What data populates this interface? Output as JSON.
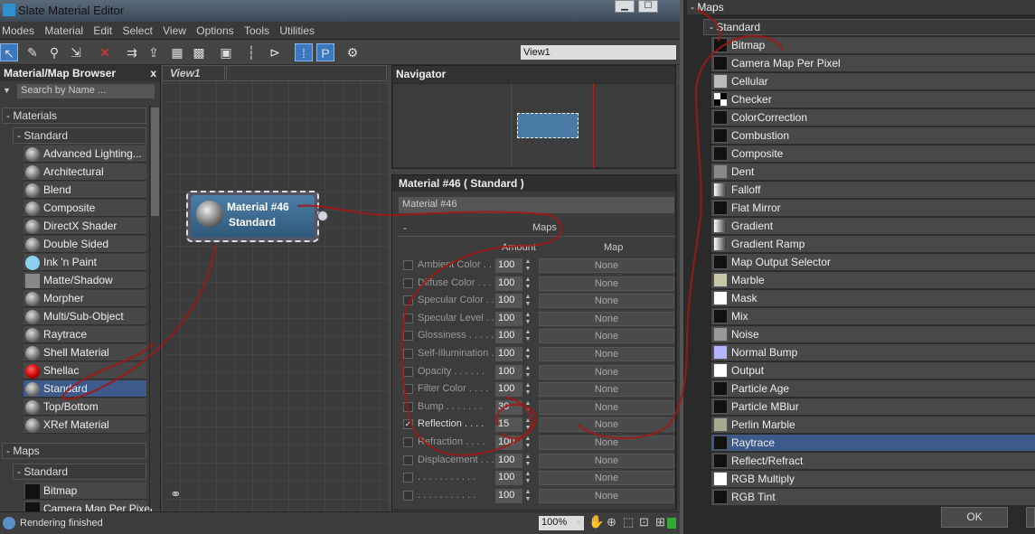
{
  "window": {
    "title": "Slate Material Editor"
  },
  "menu": [
    "Modes",
    "Material",
    "Edit",
    "Select",
    "View",
    "Options",
    "Tools",
    "Utilities"
  ],
  "view_selector": {
    "value": "View1"
  },
  "browser": {
    "title": "Material/Map Browser",
    "close": "x",
    "search_placeholder": "Search by Name ...",
    "materials_group": "- Materials",
    "standard_group": "- Standard",
    "materials": [
      {
        "label": "Advanced Lighting..."
      },
      {
        "label": "Architectural"
      },
      {
        "label": "Blend"
      },
      {
        "label": "Composite"
      },
      {
        "label": "DirectX Shader"
      },
      {
        "label": "Double Sided"
      },
      {
        "label": "Ink 'n Paint"
      },
      {
        "label": "Matte/Shadow"
      },
      {
        "label": "Morpher"
      },
      {
        "label": "Multi/Sub-Object"
      },
      {
        "label": "Raytrace"
      },
      {
        "label": "Shell Material"
      },
      {
        "label": "Shellac"
      },
      {
        "label": "Standard"
      },
      {
        "label": "Top/Bottom"
      },
      {
        "label": "XRef Material"
      }
    ],
    "selected_material": "Standard",
    "maps_group": "- Maps",
    "maps_standard_group": "- Standard",
    "maps_items": [
      {
        "label": "Bitmap"
      },
      {
        "label": "Camera Map Per Pixel"
      }
    ]
  },
  "view": {
    "tab": "View1",
    "node": {
      "name": "Material #46",
      "type": "Standard"
    }
  },
  "navigator": {
    "title": "Navigator"
  },
  "material": {
    "title": "Material #46  ( Standard )",
    "name_value": "Material #46",
    "rollout": "Maps",
    "rollout_collapse": "-",
    "col_amount": "Amount",
    "col_map": "Map",
    "params": [
      {
        "name": "Ambient Color . .",
        "amount": "100",
        "map": "None",
        "checked": false
      },
      {
        "name": "Diffuse Color . . . .",
        "amount": "100",
        "map": "None",
        "checked": false
      },
      {
        "name": "Specular Color  . .",
        "amount": "100",
        "map": "None",
        "checked": false
      },
      {
        "name": "Specular Level  . .",
        "amount": "100",
        "map": "None",
        "checked": false
      },
      {
        "name": "Glossiness . . . . .",
        "amount": "100",
        "map": "None",
        "checked": false
      },
      {
        "name": "Self-Illumination . .",
        "amount": "100",
        "map": "None",
        "checked": false
      },
      {
        "name": "Opacity . . . . . .",
        "amount": "100",
        "map": "None",
        "checked": false
      },
      {
        "name": "Filter Color  . . . .",
        "amount": "100",
        "map": "None",
        "checked": false
      },
      {
        "name": "Bump  . . . . . . .",
        "amount": "30",
        "map": "None",
        "checked": false
      },
      {
        "name": "Reflection  . . . .",
        "amount": "15",
        "map": "None",
        "checked": true
      },
      {
        "name": "Refraction  . . . .",
        "amount": "100",
        "map": "None",
        "checked": false
      },
      {
        "name": "Displacement  . . .",
        "amount": "100",
        "map": "None",
        "checked": false
      },
      {
        "name": ". . . . . . . . . . .",
        "amount": "100",
        "map": "None",
        "checked": false
      },
      {
        "name": ". . . . . . . . . . .",
        "amount": "100",
        "map": "None",
        "checked": false
      }
    ]
  },
  "status": {
    "text": "Rendering finished",
    "zoom": "100%"
  },
  "maps_panel": {
    "header": "- Maps",
    "subheader": "- Standard",
    "items": [
      {
        "label": "Bitmap",
        "swatch": "#111111"
      },
      {
        "label": "Camera Map Per Pixel",
        "swatch": "#111111"
      },
      {
        "label": "Cellular",
        "swatch": "#bbbbbb"
      },
      {
        "label": "Checker",
        "swatch": "#ffffff"
      },
      {
        "label": "ColorCorrection",
        "swatch": "#111111"
      },
      {
        "label": "Combustion",
        "swatch": "#111111"
      },
      {
        "label": "Composite",
        "swatch": "#111111"
      },
      {
        "label": "Dent",
        "swatch": "#888888"
      },
      {
        "label": "Falloff",
        "swatch": "#dddddd"
      },
      {
        "label": "Flat Mirror",
        "swatch": "#111111"
      },
      {
        "label": "Gradient",
        "swatch": "#aaaaaa"
      },
      {
        "label": "Gradient Ramp",
        "swatch": "#999999"
      },
      {
        "label": "Map Output Selector",
        "swatch": "#111111"
      },
      {
        "label": "Marble",
        "swatch": "#c8c8a8"
      },
      {
        "label": "Mask",
        "swatch": "#ffffff"
      },
      {
        "label": "Mix",
        "swatch": "#111111"
      },
      {
        "label": "Noise",
        "swatch": "#999999"
      },
      {
        "label": "Normal Bump",
        "swatch": "#b4b4ff"
      },
      {
        "label": "Output",
        "swatch": "#ffffff"
      },
      {
        "label": "Particle Age",
        "swatch": "#111111"
      },
      {
        "label": "Particle MBlur",
        "swatch": "#111111"
      },
      {
        "label": "Perlin Marble",
        "swatch": "#a8a890"
      },
      {
        "label": "Raytrace",
        "swatch": "#111111"
      },
      {
        "label": "Reflect/Refract",
        "swatch": "#111111"
      },
      {
        "label": "RGB Multiply",
        "swatch": "#ffffff"
      },
      {
        "label": "RGB Tint",
        "swatch": "#111111"
      }
    ],
    "selected": "Raytrace",
    "ok_label": "OK"
  },
  "colors": {
    "selection": "#3d5a8a",
    "ink": "#a01818",
    "node": "#4d7ea8"
  }
}
